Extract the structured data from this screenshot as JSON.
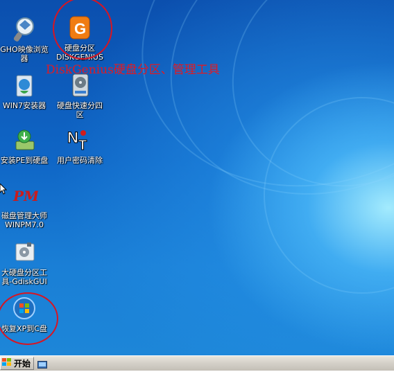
{
  "desktop": {
    "icons": [
      {
        "label": "GHO映像浏览\n器"
      },
      {
        "label": "硬盘分区\nDISKGENIUS"
      },
      {
        "label": "WIN7安装器"
      },
      {
        "label": "硬盘快速分四\n区"
      },
      {
        "label": "安装PE到硬盘"
      },
      {
        "label": "用户密码清除"
      },
      {
        "label": "磁盘管理大师\nWINPM7.0"
      },
      {
        "label": "大硬盘分区工\n具-GdiskGUI"
      },
      {
        "label": "恢复XP到C盘"
      }
    ],
    "annotation_text": "DiskGenius硬盘分区、管理工具",
    "annotation_color": "#d81522"
  },
  "taskbar": {
    "start_label": "开始"
  },
  "icons_semantic": [
    "gho-viewer-icon",
    "diskgenius-icon",
    "win7-installer-icon",
    "quick-partition-icon",
    "install-pe-icon",
    "password-clear-icon",
    "partition-master-icon",
    "gdisk-icon",
    "restore-xp-icon"
  ]
}
